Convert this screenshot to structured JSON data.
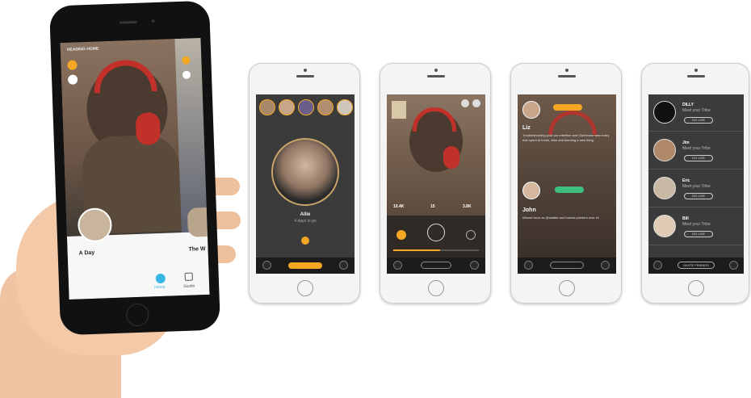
{
  "phone_main": {
    "header_label": "HEADING HOME",
    "card_title": "A Day",
    "card_title_2": "The W",
    "nav_items": [
      "Home",
      "Create",
      "Studio"
    ]
  },
  "screen_2": {
    "user_name": "Allie",
    "user_sub": "4 days to go"
  },
  "screen_3": {
    "stats": [
      "10.4K",
      "15",
      "3.8K"
    ]
  },
  "screen_4": {
    "user_1_name": "Liz",
    "user_1_text": "Troubleshooting your car rebellion and Clubhouse was every ride spent at home, #fun and learning a new thing",
    "user_2_name": "John",
    "user_2_text": "Whose truck as @seattle and tutorial pointers ever #1"
  },
  "screen_5": {
    "rows": [
      {
        "name": "DILLY",
        "sub": "Meet your Tribe"
      },
      {
        "name": "Jim",
        "sub": "Meet your Tribe"
      },
      {
        "name": "Eric",
        "sub": "Meet your Tribe"
      },
      {
        "name": "Bill",
        "sub": "Meet your Tribe"
      }
    ],
    "row_button": "GO LIVE",
    "footer_button": "INVITE FRIENDS"
  },
  "colors": {
    "accent_orange": "#f5a623",
    "accent_green": "#3fbf7f",
    "app_bg": "#3b3b3b",
    "headphone_red": "#c2302a"
  }
}
